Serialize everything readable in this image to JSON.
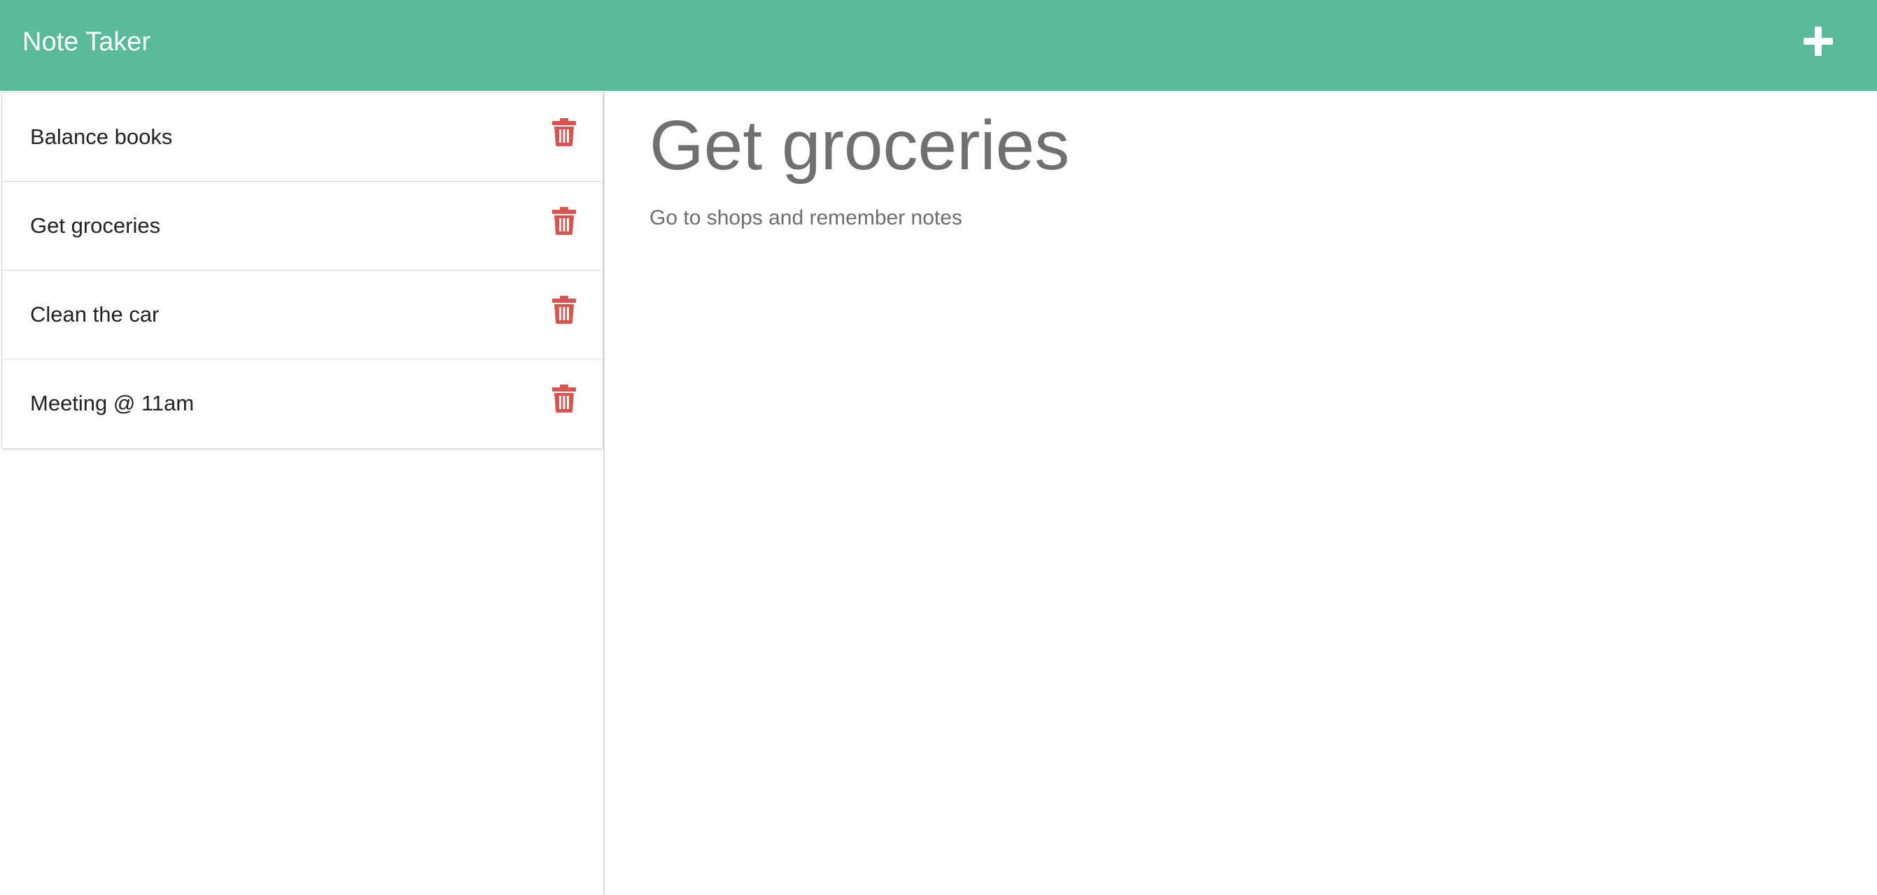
{
  "app": {
    "title": "Note Taker",
    "accent_color": "#5bba9c"
  },
  "header": {
    "add_button_icon": "plus-icon"
  },
  "sidebar": {
    "delete_icon": "trash-icon",
    "delete_color": "#d9534f",
    "notes": [
      {
        "title": "Balance books"
      },
      {
        "title": "Get groceries"
      },
      {
        "title": "Clean the car"
      },
      {
        "title": "Meeting @ 11am"
      }
    ]
  },
  "editor": {
    "title_value": "Get groceries",
    "text_value": "Go to shops and remember notes"
  }
}
